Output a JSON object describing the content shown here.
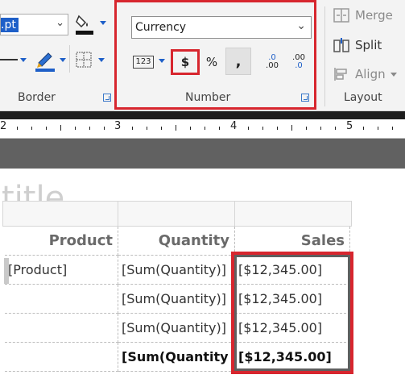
{
  "ribbon": {
    "font_size_value": ".pt",
    "border": {
      "label": "Border"
    },
    "number": {
      "label": "Number",
      "format_value": "Currency",
      "placeholders_icon_text": "123",
      "currency_label": "$",
      "percent_label": "%",
      "comma_label": ",",
      "increase_decimal_top": ".0",
      "increase_decimal_bottom": ".00",
      "decrease_decimal_top": ".00",
      "decrease_decimal_bottom": ".0"
    },
    "layout": {
      "label": "Layout",
      "merge_label": "Merge",
      "split_label": "Split",
      "align_label": "Align"
    }
  },
  "ruler": {
    "numbers": [
      "2",
      "3",
      "4",
      "5"
    ]
  },
  "report": {
    "ghost_title": "title",
    "headers": [
      "Product",
      "Quantity",
      "Sales"
    ],
    "rows": [
      {
        "product": "[Product]",
        "quantity": "[Sum(Quantity)]",
        "sales": "[$12,345.00]"
      },
      {
        "product": "",
        "quantity": "[Sum(Quantity)]",
        "sales": "[$12,345.00]"
      },
      {
        "product": "",
        "quantity": "[Sum(Quantity)]",
        "sales": "[$12,345.00]"
      },
      {
        "product": "",
        "quantity": "[Sum(Quantity",
        "sales": "[$12,345.00]"
      }
    ]
  },
  "colors": {
    "highlight": "#d7262e",
    "accent": "#1e5fc8"
  }
}
